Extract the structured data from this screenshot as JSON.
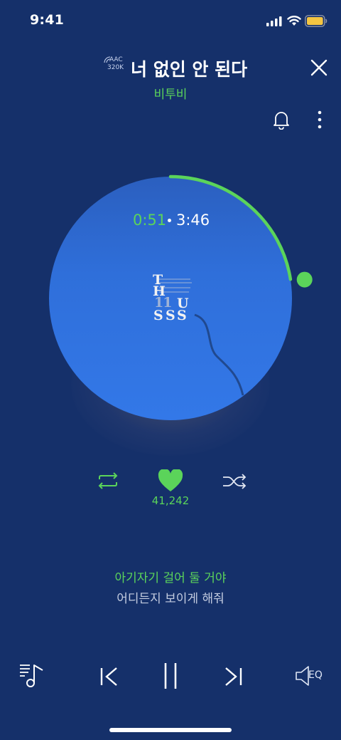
{
  "status_bar": {
    "time": "9:41"
  },
  "header": {
    "codec_top": "AAC",
    "codec_bottom": "320K",
    "song_title": "너 없인 안 된다",
    "artist": "비투비"
  },
  "player": {
    "elapsed": "0:51",
    "total": "3:46",
    "progress_fraction": 0.225,
    "album_art_text": [
      "T",
      "H",
      "11",
      "U",
      "S",
      "S",
      "S"
    ],
    "like_count": "41,242"
  },
  "lyrics": {
    "current": "아기자기 걸어 둘 거야",
    "next": "어디든지 보이게 해줘"
  },
  "bottom_bar": {
    "eq_label": "EQ"
  },
  "colors": {
    "accent": "#5bd45a",
    "background": "#15306a",
    "disc": "#2f6fda"
  },
  "icons": [
    "signal-icon",
    "wifi-icon",
    "battery-icon",
    "close-icon",
    "bell-icon",
    "more-icon",
    "repeat-icon",
    "heart-icon",
    "shuffle-icon",
    "playlist-icon",
    "previous-icon",
    "pause-icon",
    "next-icon",
    "eq-icon"
  ]
}
